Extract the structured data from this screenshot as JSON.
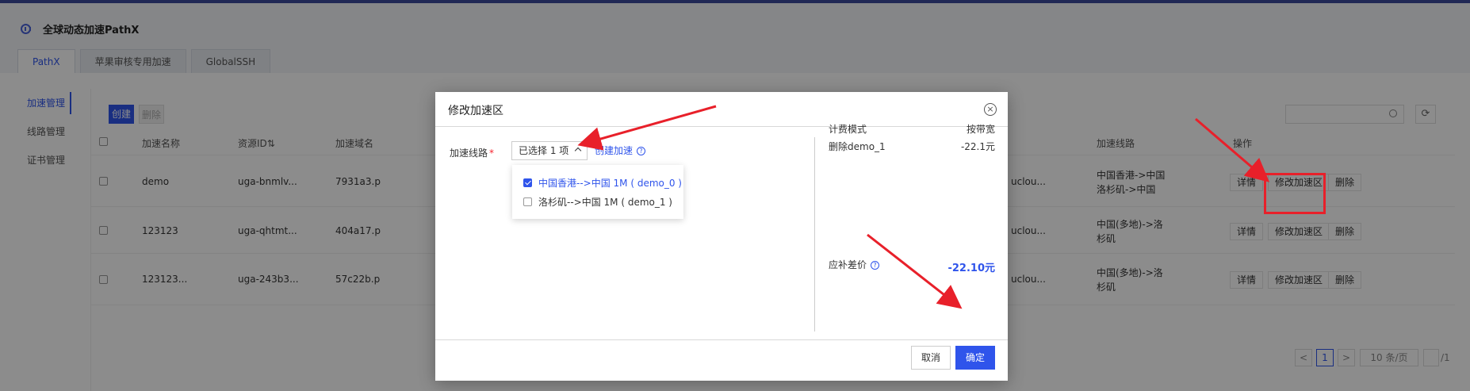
{
  "app": {
    "title": "全球动态加速PathX"
  },
  "tabs": [
    {
      "label": "PathX"
    },
    {
      "label": "苹果审核专用加速"
    },
    {
      "label": "GlobalSSH"
    }
  ],
  "sidebar": {
    "items": [
      {
        "label": "加速管理"
      },
      {
        "label": "线路管理"
      },
      {
        "label": "证书管理"
      }
    ]
  },
  "toolbar": {
    "create_label": "创建",
    "delete_label": "删除"
  },
  "table": {
    "headers": {
      "name": "加速名称",
      "resource_id": "资源ID⇅",
      "domain": "加速域名",
      "line": "加速线路",
      "ops": "操作"
    },
    "rows": [
      {
        "name": "demo",
        "resource_id": "uga-bnmlv...",
        "domain": "7931a3.p",
        "region": "uclou...",
        "line_1": "中国香港->中国",
        "line_2": "洛杉矶->中国",
        "op_detail": "详情",
        "op_modify": "修改加速区",
        "op_delete": "删除"
      },
      {
        "name": "123123",
        "resource_id": "uga-qhtmt...",
        "domain": "404a17.p",
        "region": "uclou...",
        "line_1": "中国(多地)->洛",
        "line_2": "杉矶",
        "op_detail": "详情",
        "op_modify": "修改加速区",
        "op_delete": "删除"
      },
      {
        "name": "123123...",
        "resource_id": "uga-243b3...",
        "domain": "57c22b.p",
        "region": "uclou...",
        "line_1": "中国(多地)->洛",
        "line_2": "杉矶",
        "op_detail": "详情",
        "op_modify": "修改加速区",
        "op_delete": "删除"
      }
    ]
  },
  "pagination": {
    "prev": "<",
    "current": "1",
    "next": ">",
    "page_size": "10 条/页",
    "total_suffix": "/1"
  },
  "modal": {
    "title": "修改加速区",
    "close_icon": "close-icon",
    "field_label": "加速线路",
    "required_mark": "*",
    "select_value": "已选择 1 项",
    "create_link": "创建加速",
    "help_glyph": "?",
    "options": [
      {
        "label": "中国香港-->中国 1M ( demo_0 )",
        "checked": true
      },
      {
        "label": "洛杉矶-->中国 1M ( demo_1 )",
        "checked": false
      }
    ],
    "pricing": {
      "mode_label": "计费模式",
      "mode_value": "按带宽",
      "item_label": "删除demo_1",
      "item_value": "-22.1元",
      "total_label": "应补差价",
      "total_value": "-22.10元"
    },
    "cancel_label": "取消",
    "ok_label": "确定"
  },
  "colors": {
    "accent": "#2f54eb",
    "annotation": "#e8202a"
  }
}
